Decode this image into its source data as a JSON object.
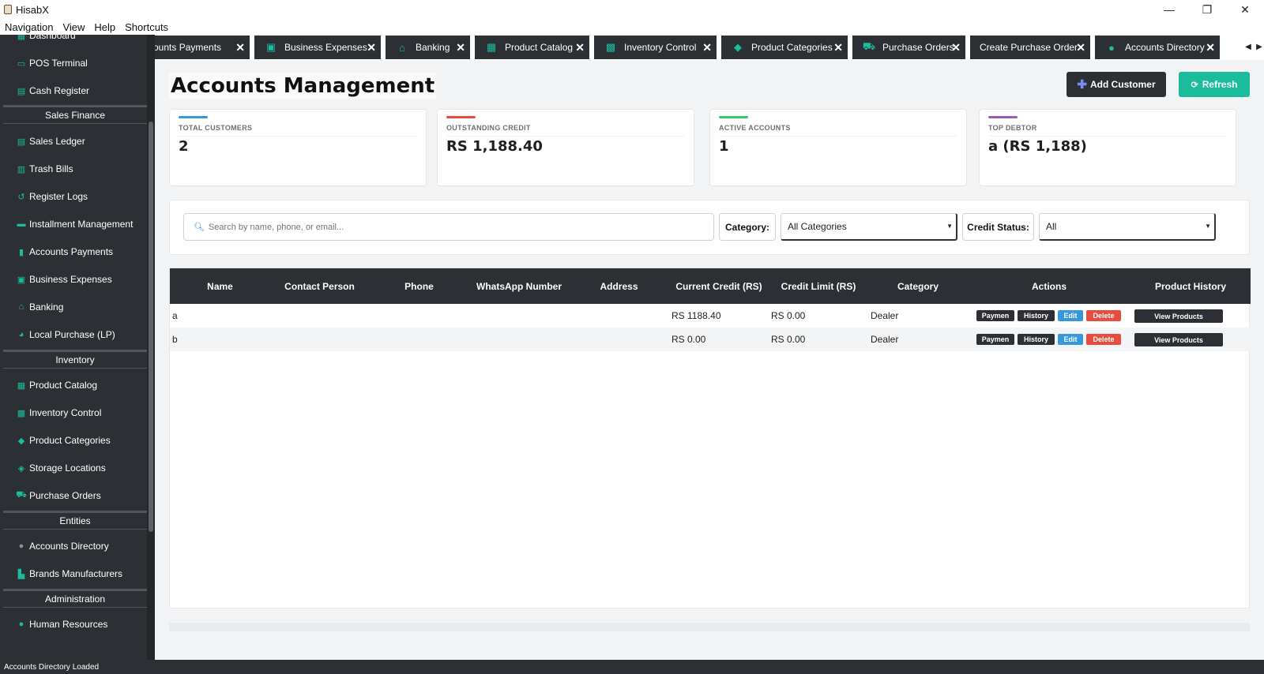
{
  "window": {
    "title": "HisabX",
    "controls": {
      "minimize": "—",
      "restore": "❐",
      "close": "✕"
    }
  },
  "menu": [
    "Navigation",
    "View",
    "Help",
    "Shortcuts"
  ],
  "sidebar": {
    "top_partial": "Dashboard",
    "items_top": [
      {
        "label": "POS Terminal",
        "icon": "monitor-icon"
      },
      {
        "label": "Cash Register",
        "icon": "cash-register-icon"
      }
    ],
    "sections": [
      {
        "title": "Sales  Finance",
        "items": [
          {
            "label": "Sales Ledger",
            "icon": "ledger-icon"
          },
          {
            "label": "Trash Bills",
            "icon": "trash-icon"
          },
          {
            "label": "Register Logs",
            "icon": "history-icon"
          },
          {
            "label": "Installment Management",
            "icon": "card-icon"
          },
          {
            "label": "Accounts  Payments",
            "icon": "invoice-icon"
          },
          {
            "label": "Business Expenses",
            "icon": "money-icon"
          },
          {
            "label": "Banking",
            "icon": "bank-icon"
          },
          {
            "label": "Local Purchase (LP)",
            "icon": "pie-icon"
          }
        ]
      },
      {
        "title": "Inventory",
        "items": [
          {
            "label": "Product Catalog",
            "icon": "boxes-icon"
          },
          {
            "label": "Inventory Control",
            "icon": "warehouse-icon"
          },
          {
            "label": "Product Categories",
            "icon": "tags-icon"
          },
          {
            "label": "Storage Locations",
            "icon": "layers-icon"
          },
          {
            "label": "Purchase Orders",
            "icon": "cart-icon"
          }
        ]
      },
      {
        "title": "Entities",
        "items": [
          {
            "label": "Accounts Directory",
            "icon": "users-icon"
          },
          {
            "label": "Brands  Manufacturers",
            "icon": "industry-icon"
          }
        ]
      },
      {
        "title": "Administration",
        "items": [
          {
            "label": "Human Resources",
            "icon": "user-icon"
          }
        ]
      }
    ]
  },
  "tabs": [
    {
      "label": "counts  Payments",
      "icon": ""
    },
    {
      "label": "Business Expenses",
      "icon": "money-icon"
    },
    {
      "label": "Banking",
      "icon": "bank-icon"
    },
    {
      "label": "Product Catalog",
      "icon": "boxes-icon"
    },
    {
      "label": "Inventory Control",
      "icon": "warehouse-icon"
    },
    {
      "label": "Product Categories",
      "icon": "tags-icon"
    },
    {
      "label": "Purchase Orders",
      "icon": "cart-icon"
    },
    {
      "label": "Create Purchase Order",
      "icon": ""
    },
    {
      "label": "Accounts Directory",
      "icon": "users-icon"
    }
  ],
  "tab_close": "✕",
  "page": {
    "title": "Accounts Management",
    "add_button": "Add Customer",
    "refresh_button": "Refresh"
  },
  "stats": [
    {
      "label": "TOTAL CUSTOMERS",
      "value": "2",
      "color": "#3498db"
    },
    {
      "label": "OUTSTANDING CREDIT",
      "value": "RS 1,188.40",
      "color": "#e74c3c"
    },
    {
      "label": "ACTIVE ACCOUNTS",
      "value": "1",
      "color": "#2ecc71"
    },
    {
      "label": "TOP DEBTOR",
      "value": "a (RS 1,188)",
      "color": "#9b59b6"
    }
  ],
  "filters": {
    "search_placeholder": "Search by name, phone, or email...",
    "category_label": "Category:",
    "category_value": "All Categories",
    "credit_label": "Credit Status:",
    "credit_value": "All"
  },
  "table": {
    "columns": [
      "Name",
      "Contact Person",
      "Phone",
      "WhatsApp Number",
      "Address",
      "Current Credit (RS)",
      "Credit Limit (RS)",
      "Category",
      "Actions",
      "Product History"
    ],
    "rows": [
      {
        "name": "a",
        "contact": "",
        "phone": "",
        "whatsapp": "",
        "address": "",
        "credit": "RS 1188.40",
        "limit": "RS 0.00",
        "category": "Dealer"
      },
      {
        "name": "b",
        "contact": "",
        "phone": "",
        "whatsapp": "",
        "address": "",
        "credit": "RS 0.00",
        "limit": "RS 0.00",
        "category": "Dealer"
      }
    ],
    "action_labels": {
      "payment": "Paymen",
      "history": "History",
      "edit": "Edit",
      "delete": "Delete"
    },
    "view_products": "View Products"
  },
  "status": "Accounts Directory Loaded",
  "colors": {
    "accent": "#1abc9c",
    "dark": "#2c3034",
    "blue": "#3498db",
    "red": "#e74c3c"
  }
}
